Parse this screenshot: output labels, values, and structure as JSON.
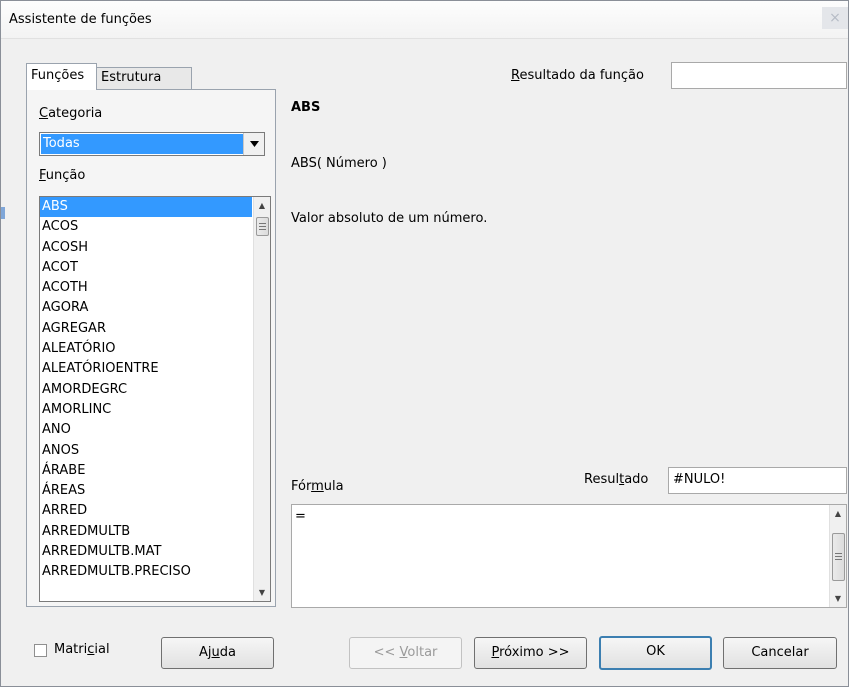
{
  "window": {
    "title": "Assistente de funções",
    "close_glyph": "×"
  },
  "tabs": [
    {
      "label": "Funções",
      "active": true
    },
    {
      "label": "Estrutura",
      "active": false
    }
  ],
  "left_panel": {
    "category_label_u": "C",
    "category_label_rest": "ategoria",
    "category_value": "Todas",
    "function_label_u": "F",
    "function_label_rest": "unção",
    "functions": [
      "ABS",
      "ACOS",
      "ACOSH",
      "ACOT",
      "ACOTH",
      "AGORA",
      "AGREGAR",
      "ALEATÓRIO",
      "ALEATÓRIOENTRE",
      "AMORDEGRC",
      "AMORLINC",
      "ANO",
      "ANOS",
      "ÁRABE",
      "ÁREAS",
      "ARRED",
      "ARREDMULTB",
      "ARREDMULTB.MAT",
      "ARREDMULTB.PRECISO"
    ],
    "selected_function": "ABS"
  },
  "right_panel": {
    "result_label_u": "R",
    "result_label_rest": "esultado da função",
    "result_value": "",
    "function_name": "ABS",
    "signature": "ABS( Número )",
    "description": "Valor absoluto de um número.",
    "formula_label_pre": "Fór",
    "formula_label_u": "m",
    "formula_label_post": "ula",
    "resultado_label_pre": "Resul",
    "resultado_label_u": "t",
    "resultado_label_post": "ado",
    "resultado_value": "#NULO!",
    "formula_text": "="
  },
  "footer": {
    "matricial_pre": "Matri",
    "matricial_u": "c",
    "matricial_post": "ial",
    "matricial_checked": false,
    "help_pre": "Aj",
    "help_u": "u",
    "help_post": "da",
    "back_pre": "<< ",
    "back_u": "V",
    "back_post": "oltar",
    "next_u": "P",
    "next_post": "róximo >>",
    "ok": "OK",
    "cancel": "Cancelar"
  },
  "icons": {
    "dropdown": "chevron-down-icon",
    "scroll_up": "scroll-up-icon",
    "scroll_down": "scroll-down-icon"
  }
}
